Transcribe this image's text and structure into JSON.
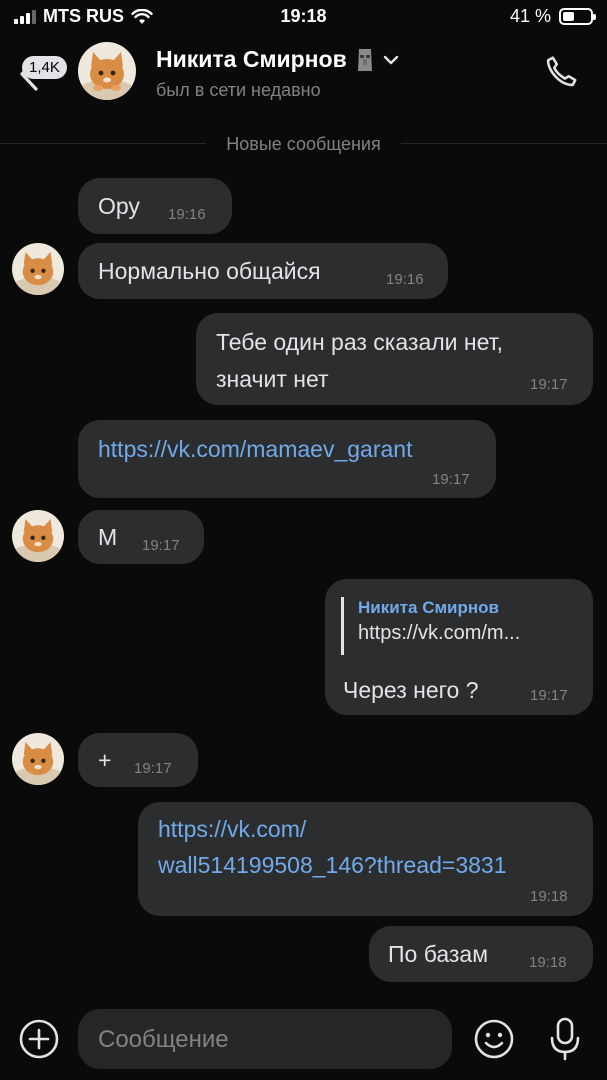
{
  "status_bar": {
    "carrier": "MTS RUS",
    "time": "19:18",
    "battery": "41 %",
    "battery_level": 0.41
  },
  "header": {
    "unread_badge": "1,4K",
    "name": "Никита Смирнов",
    "status": "был в сети недавно"
  },
  "divider_label": "Новые сообщения",
  "messages": [
    {
      "text": "Ору",
      "time": "19:16",
      "side": "in"
    },
    {
      "text": "Нормально общайся",
      "time": "19:16",
      "side": "in"
    },
    {
      "text_line1": "Тебе один раз сказали нет,",
      "text_line2": "значит нет",
      "time": "19:17",
      "side": "out"
    },
    {
      "text": "https://vk.com/mamaev_garant",
      "time": "19:17",
      "side": "in"
    },
    {
      "text": "М",
      "time": "19:17",
      "side": "in"
    },
    {
      "reply_author": "Никита Смирнов",
      "reply_text": "https://vk.com/m...",
      "text": "Через него ?",
      "time": "19:17",
      "side": "out"
    },
    {
      "text": "+",
      "time": "19:17",
      "side": "in"
    },
    {
      "text_line1": "https://vk.com/",
      "text_line2": "wall514199508_146?thread=3831",
      "time": "19:18",
      "side": "out"
    },
    {
      "text": "По базам",
      "time": "19:18",
      "side": "out"
    }
  ],
  "input": {
    "placeholder": "Сообщение"
  },
  "icons": {
    "back": "chevron-left-icon",
    "call": "phone-icon",
    "attach": "plus-circle-icon",
    "emoji": "smiley-icon",
    "mic": "microphone-icon",
    "dropdown": "chevron-down-icon",
    "name_emoji": "moai-emoji",
    "wifi": "wifi-icon",
    "signal": "signal-icon",
    "battery": "battery-icon"
  }
}
